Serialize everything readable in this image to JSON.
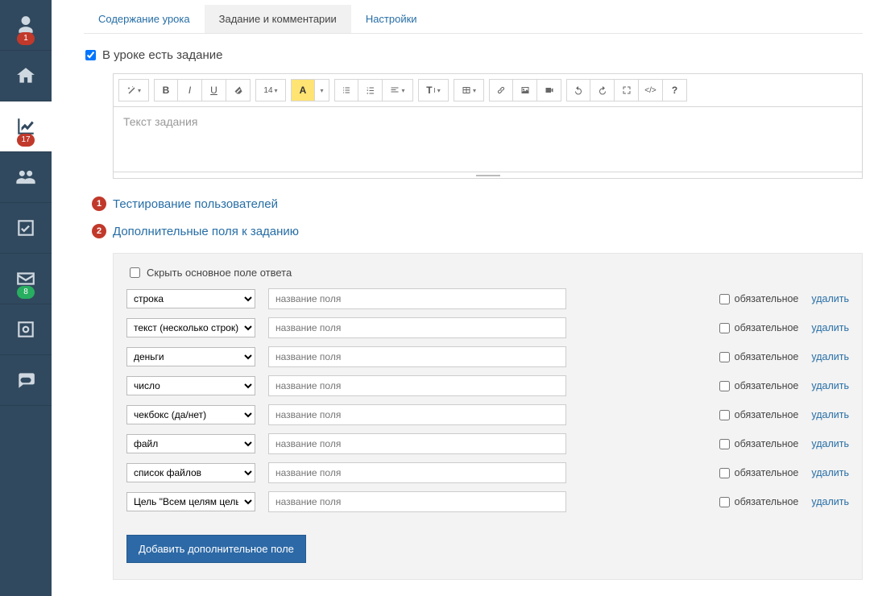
{
  "sidebar": {
    "items": [
      {
        "icon": "user",
        "badge": "1",
        "badgeColor": "red"
      },
      {
        "icon": "home"
      },
      {
        "icon": "chart",
        "badge": "17",
        "badgeColor": "red",
        "active": true
      },
      {
        "icon": "users"
      },
      {
        "icon": "check"
      },
      {
        "icon": "mail",
        "badge": "8",
        "badgeColor": "green"
      },
      {
        "icon": "gear-box"
      },
      {
        "icon": "chat"
      }
    ]
  },
  "tabs": {
    "items": [
      {
        "label": "Содержание урока"
      },
      {
        "label": "Задание и комментарии",
        "active": true
      },
      {
        "label": "Настройки"
      }
    ]
  },
  "hasTask": {
    "label": "В уроке есть задание",
    "checked": true
  },
  "editor": {
    "placeholder": "Текст задания",
    "fontSize": "14",
    "toolbar_icons": [
      "magic",
      "bold",
      "italic",
      "underline",
      "eraser",
      "fontsize",
      "highlight",
      "ul",
      "ol",
      "align",
      "text-style",
      "table",
      "link",
      "image",
      "video",
      "undo",
      "redo",
      "expand",
      "code",
      "help"
    ]
  },
  "steps": {
    "one": {
      "num": "1",
      "label": "Тестирование пользователей"
    },
    "two": {
      "num": "2",
      "label": "Дополнительные поля к заданию"
    }
  },
  "fieldsPanel": {
    "hideMain": {
      "label": "Скрыть основное поле ответа",
      "checked": false
    },
    "placeholder": "название поля",
    "requiredLabel": "обязательное",
    "deleteLabel": "удалить",
    "addButton": "Добавить дополнительное поле",
    "rows": [
      {
        "type": "строка"
      },
      {
        "type": "текст (несколько строк)"
      },
      {
        "type": "деньги"
      },
      {
        "type": "число"
      },
      {
        "type": "чекбокс (да/нет)"
      },
      {
        "type": "файл"
      },
      {
        "type": "список файлов"
      },
      {
        "type": "Цель \"Всем целям цель\""
      }
    ]
  }
}
